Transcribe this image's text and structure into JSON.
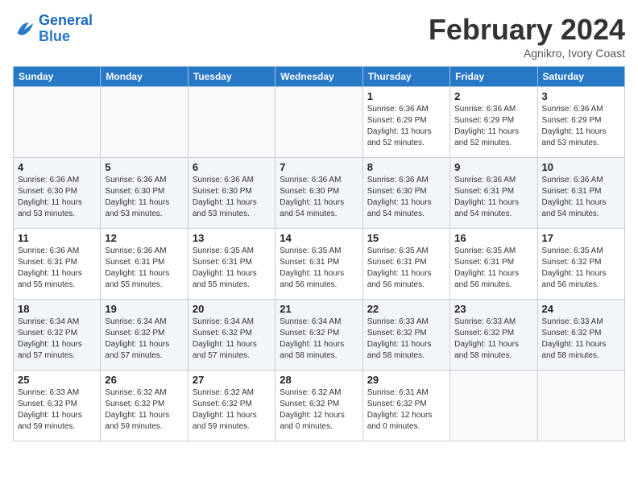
{
  "header": {
    "logo_line1": "General",
    "logo_line2": "Blue",
    "month": "February 2024",
    "location": "Agnikro, Ivory Coast"
  },
  "weekdays": [
    "Sunday",
    "Monday",
    "Tuesday",
    "Wednesday",
    "Thursday",
    "Friday",
    "Saturday"
  ],
  "weeks": [
    [
      {
        "day": "",
        "info": ""
      },
      {
        "day": "",
        "info": ""
      },
      {
        "day": "",
        "info": ""
      },
      {
        "day": "",
        "info": ""
      },
      {
        "day": "1",
        "info": "Sunrise: 6:36 AM\nSunset: 6:29 PM\nDaylight: 11 hours\nand 52 minutes."
      },
      {
        "day": "2",
        "info": "Sunrise: 6:36 AM\nSunset: 6:29 PM\nDaylight: 11 hours\nand 52 minutes."
      },
      {
        "day": "3",
        "info": "Sunrise: 6:36 AM\nSunset: 6:29 PM\nDaylight: 11 hours\nand 53 minutes."
      }
    ],
    [
      {
        "day": "4",
        "info": "Sunrise: 6:36 AM\nSunset: 6:30 PM\nDaylight: 11 hours\nand 53 minutes."
      },
      {
        "day": "5",
        "info": "Sunrise: 6:36 AM\nSunset: 6:30 PM\nDaylight: 11 hours\nand 53 minutes."
      },
      {
        "day": "6",
        "info": "Sunrise: 6:36 AM\nSunset: 6:30 PM\nDaylight: 11 hours\nand 53 minutes."
      },
      {
        "day": "7",
        "info": "Sunrise: 6:36 AM\nSunset: 6:30 PM\nDaylight: 11 hours\nand 54 minutes."
      },
      {
        "day": "8",
        "info": "Sunrise: 6:36 AM\nSunset: 6:30 PM\nDaylight: 11 hours\nand 54 minutes."
      },
      {
        "day": "9",
        "info": "Sunrise: 6:36 AM\nSunset: 6:31 PM\nDaylight: 11 hours\nand 54 minutes."
      },
      {
        "day": "10",
        "info": "Sunrise: 6:36 AM\nSunset: 6:31 PM\nDaylight: 11 hours\nand 54 minutes."
      }
    ],
    [
      {
        "day": "11",
        "info": "Sunrise: 6:36 AM\nSunset: 6:31 PM\nDaylight: 11 hours\nand 55 minutes."
      },
      {
        "day": "12",
        "info": "Sunrise: 6:36 AM\nSunset: 6:31 PM\nDaylight: 11 hours\nand 55 minutes."
      },
      {
        "day": "13",
        "info": "Sunrise: 6:35 AM\nSunset: 6:31 PM\nDaylight: 11 hours\nand 55 minutes."
      },
      {
        "day": "14",
        "info": "Sunrise: 6:35 AM\nSunset: 6:31 PM\nDaylight: 11 hours\nand 56 minutes."
      },
      {
        "day": "15",
        "info": "Sunrise: 6:35 AM\nSunset: 6:31 PM\nDaylight: 11 hours\nand 56 minutes."
      },
      {
        "day": "16",
        "info": "Sunrise: 6:35 AM\nSunset: 6:31 PM\nDaylight: 11 hours\nand 56 minutes."
      },
      {
        "day": "17",
        "info": "Sunrise: 6:35 AM\nSunset: 6:32 PM\nDaylight: 11 hours\nand 56 minutes."
      }
    ],
    [
      {
        "day": "18",
        "info": "Sunrise: 6:34 AM\nSunset: 6:32 PM\nDaylight: 11 hours\nand 57 minutes."
      },
      {
        "day": "19",
        "info": "Sunrise: 6:34 AM\nSunset: 6:32 PM\nDaylight: 11 hours\nand 57 minutes."
      },
      {
        "day": "20",
        "info": "Sunrise: 6:34 AM\nSunset: 6:32 PM\nDaylight: 11 hours\nand 57 minutes."
      },
      {
        "day": "21",
        "info": "Sunrise: 6:34 AM\nSunset: 6:32 PM\nDaylight: 11 hours\nand 58 minutes."
      },
      {
        "day": "22",
        "info": "Sunrise: 6:33 AM\nSunset: 6:32 PM\nDaylight: 11 hours\nand 58 minutes."
      },
      {
        "day": "23",
        "info": "Sunrise: 6:33 AM\nSunset: 6:32 PM\nDaylight: 11 hours\nand 58 minutes."
      },
      {
        "day": "24",
        "info": "Sunrise: 6:33 AM\nSunset: 6:32 PM\nDaylight: 11 hours\nand 58 minutes."
      }
    ],
    [
      {
        "day": "25",
        "info": "Sunrise: 6:33 AM\nSunset: 6:32 PM\nDaylight: 11 hours\nand 59 minutes."
      },
      {
        "day": "26",
        "info": "Sunrise: 6:32 AM\nSunset: 6:32 PM\nDaylight: 11 hours\nand 59 minutes."
      },
      {
        "day": "27",
        "info": "Sunrise: 6:32 AM\nSunset: 6:32 PM\nDaylight: 11 hours\nand 59 minutes."
      },
      {
        "day": "28",
        "info": "Sunrise: 6:32 AM\nSunset: 6:32 PM\nDaylight: 12 hours\nand 0 minutes."
      },
      {
        "day": "29",
        "info": "Sunrise: 6:31 AM\nSunset: 6:32 PM\nDaylight: 12 hours\nand 0 minutes."
      },
      {
        "day": "",
        "info": ""
      },
      {
        "day": "",
        "info": ""
      }
    ]
  ]
}
